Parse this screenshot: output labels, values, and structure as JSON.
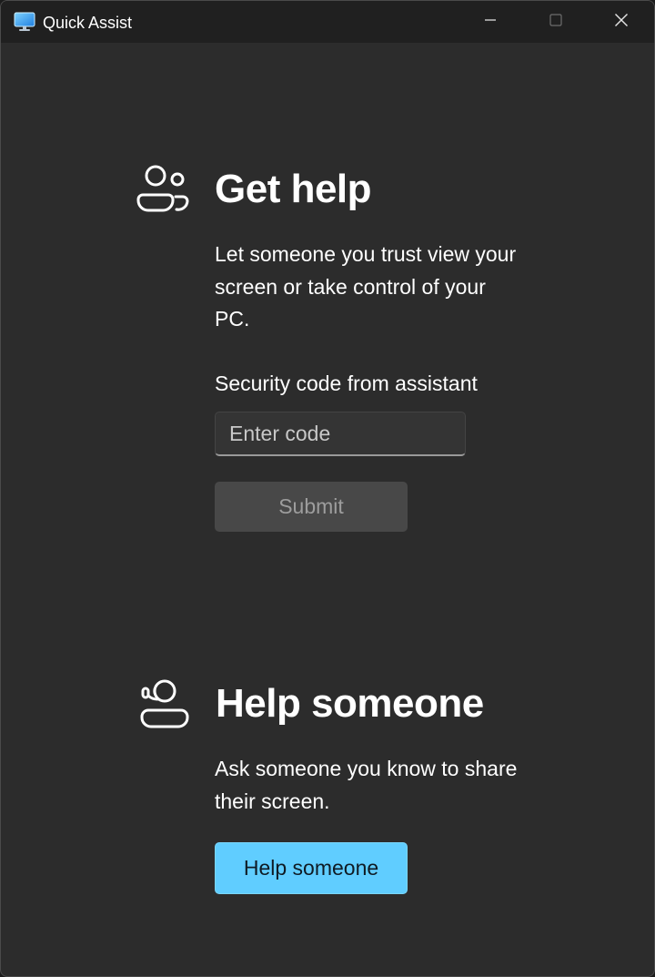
{
  "titlebar": {
    "app_icon": "quick-assist-monitor-icon",
    "title": "Quick Assist",
    "buttons": {
      "minimize": "minimize-icon",
      "maximize": "maximize-icon",
      "close": "close-icon"
    }
  },
  "get_help": {
    "icon": "people-icon",
    "heading": "Get help",
    "description": "Let someone you trust view your screen or take control of your PC.",
    "code_label": "Security code from assistant",
    "code_input": {
      "value": "",
      "placeholder": "Enter code"
    },
    "submit_label": "Submit",
    "submit_enabled": false
  },
  "help_someone": {
    "icon": "person-headset-icon",
    "heading": "Help someone",
    "description": "Ask someone you know to share their screen.",
    "button_label": "Help someone"
  },
  "colors": {
    "background": "#2c2c2c",
    "titlebar": "#202020",
    "accent": "#60cdff",
    "disabled_button": "#484848",
    "text": "#ffffff"
  }
}
